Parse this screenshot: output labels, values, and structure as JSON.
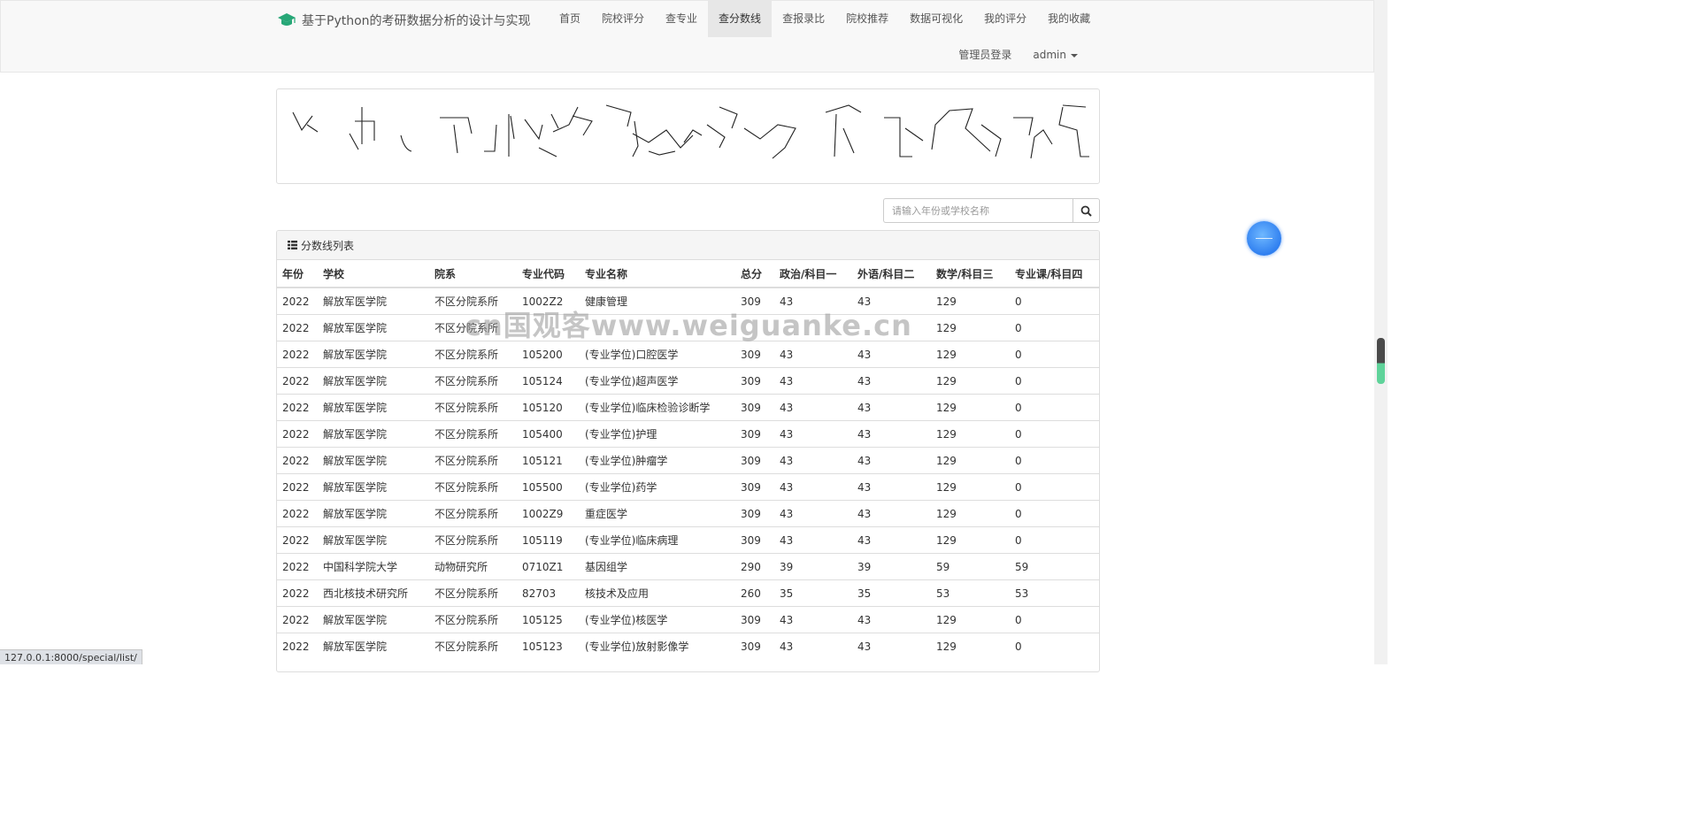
{
  "brand": {
    "title": "基于Python的考研数据分析的设计与实现",
    "icon": "graduation-cap-icon",
    "icon_color": "#27a777"
  },
  "nav": {
    "items": [
      {
        "label": "首页"
      },
      {
        "label": "院校评分"
      },
      {
        "label": "查专业"
      },
      {
        "label": "查分数线",
        "active": true
      },
      {
        "label": "查报录比"
      },
      {
        "label": "院校推荐"
      },
      {
        "label": "数据可视化"
      },
      {
        "label": "我的评分"
      },
      {
        "label": "我的收藏"
      }
    ],
    "admin_login": "管理员登录",
    "user": "admin"
  },
  "search": {
    "placeholder": "请输入年份或学校名称",
    "value": "",
    "icon": "search-icon"
  },
  "panel": {
    "title": "分数线列表",
    "icon": "list-icon"
  },
  "table": {
    "columns": [
      "年份",
      "学校",
      "院系",
      "专业代码",
      "专业名称",
      "总分",
      "政治/科目一",
      "外语/科目二",
      "数学/科目三",
      "专业课/科目四"
    ],
    "rows": [
      [
        "2022",
        "解放军医学院",
        "不区分院系所",
        "1002Z2",
        "健康管理",
        "309",
        "43",
        "43",
        "129",
        "0"
      ],
      [
        "2022",
        "解放军医学院",
        "不区分院系所",
        "",
        "",
        "",
        "",
        "",
        "129",
        "0"
      ],
      [
        "2022",
        "解放军医学院",
        "不区分院系所",
        "105200",
        "(专业学位)口腔医学",
        "309",
        "43",
        "43",
        "129",
        "0"
      ],
      [
        "2022",
        "解放军医学院",
        "不区分院系所",
        "105124",
        "(专业学位)超声医学",
        "309",
        "43",
        "43",
        "129",
        "0"
      ],
      [
        "2022",
        "解放军医学院",
        "不区分院系所",
        "105120",
        "(专业学位)临床检验诊断学",
        "309",
        "43",
        "43",
        "129",
        "0"
      ],
      [
        "2022",
        "解放军医学院",
        "不区分院系所",
        "105400",
        "(专业学位)护理",
        "309",
        "43",
        "43",
        "129",
        "0"
      ],
      [
        "2022",
        "解放军医学院",
        "不区分院系所",
        "105121",
        "(专业学位)肿瘤学",
        "309",
        "43",
        "43",
        "129",
        "0"
      ],
      [
        "2022",
        "解放军医学院",
        "不区分院系所",
        "105500",
        "(专业学位)药学",
        "309",
        "43",
        "43",
        "129",
        "0"
      ],
      [
        "2022",
        "解放军医学院",
        "不区分院系所",
        "1002Z9",
        "重症医学",
        "309",
        "43",
        "43",
        "129",
        "0"
      ],
      [
        "2022",
        "解放军医学院",
        "不区分院系所",
        "105119",
        "(专业学位)临床病理",
        "309",
        "43",
        "43",
        "129",
        "0"
      ],
      [
        "2022",
        "中国科学院大学",
        "动物研究所",
        "0710Z1",
        "基因组学",
        "290",
        "39",
        "39",
        "59",
        "59"
      ],
      [
        "2022",
        "西北核技术研究所",
        "不区分院系所",
        "82703",
        "核技术及应用",
        "260",
        "35",
        "35",
        "53",
        "53"
      ],
      [
        "2022",
        "解放军医学院",
        "不区分院系所",
        "105125",
        "(专业学位)核医学",
        "309",
        "43",
        "43",
        "129",
        "0"
      ],
      [
        "2022",
        "解放军医学院",
        "不区分院系所",
        "105123",
        "(专业学位)放射影像学",
        "309",
        "43",
        "43",
        "129",
        "0"
      ]
    ]
  },
  "watermark": "cn国观客www.weiguanke.cn",
  "status_url": "127.0.0.1:8000/special/list/"
}
